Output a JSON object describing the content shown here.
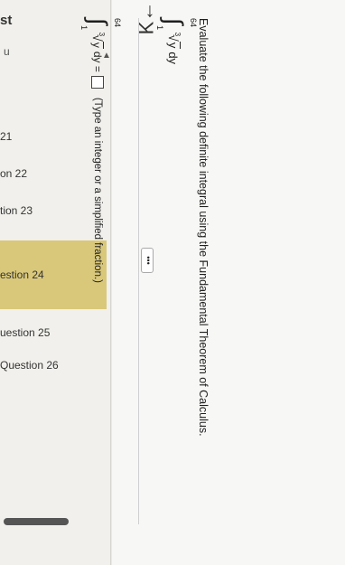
{
  "sidebar": {
    "header": "st",
    "sub": "u",
    "items": [
      {
        "label": "21"
      },
      {
        "label": "on 22"
      },
      {
        "label": "tion 23"
      },
      {
        "label": "estion 24"
      },
      {
        "label": "uestion 25"
      },
      {
        "label": "Question 26"
      }
    ]
  },
  "nav": {
    "back_icon": "K←"
  },
  "question": {
    "prompt": "Evaluate the following definite integral using the Fundamental Theorem of Calculus.",
    "upper_limit": "64",
    "lower_limit": "1",
    "root_index": "3",
    "variable": "y",
    "differential": "dy",
    "more_label": "•••",
    "answer_suffix": "dy =",
    "instruction": "(Type an integer or a simplified fraction.)"
  }
}
